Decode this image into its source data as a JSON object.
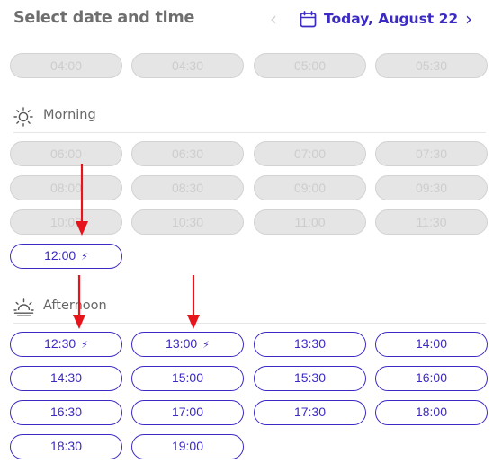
{
  "header": {
    "title": "Select date and time",
    "date_label": "Today, August 22",
    "prev_icon": "chevron-left-icon",
    "next_icon": "chevron-right-icon",
    "calendar_icon": "calendar-icon"
  },
  "colors": {
    "accent": "#3b2ac4",
    "disabled_bg": "#e5e5e5",
    "disabled_text": "#cdcdcd",
    "annotation_arrow": "#e8141b"
  },
  "early": {
    "slots": [
      {
        "time": "04:00",
        "available": false
      },
      {
        "time": "04:30",
        "available": false
      },
      {
        "time": "05:00",
        "available": false
      },
      {
        "time": "05:30",
        "available": false
      }
    ]
  },
  "morning": {
    "label": "Morning",
    "icon": "sun-icon",
    "slots": [
      {
        "time": "06:00",
        "available": false
      },
      {
        "time": "06:30",
        "available": false
      },
      {
        "time": "07:00",
        "available": false
      },
      {
        "time": "07:30",
        "available": false
      },
      {
        "time": "08:00",
        "available": false
      },
      {
        "time": "08:30",
        "available": false
      },
      {
        "time": "09:00",
        "available": false
      },
      {
        "time": "09:30",
        "available": false
      },
      {
        "time": "10:00",
        "available": false
      },
      {
        "time": "10:30",
        "available": false
      },
      {
        "time": "11:00",
        "available": false
      },
      {
        "time": "11:30",
        "available": false
      },
      {
        "time": "12:00",
        "available": true,
        "bolt": true
      }
    ]
  },
  "afternoon": {
    "label": "Afternoon",
    "icon": "sunset-icon",
    "slots": [
      {
        "time": "12:30",
        "available": true,
        "bolt": true
      },
      {
        "time": "13:00",
        "available": true,
        "bolt": true
      },
      {
        "time": "13:30",
        "available": true
      },
      {
        "time": "14:00",
        "available": true
      },
      {
        "time": "14:30",
        "available": true
      },
      {
        "time": "15:00",
        "available": true
      },
      {
        "time": "15:30",
        "available": true
      },
      {
        "time": "16:00",
        "available": true
      },
      {
        "time": "16:30",
        "available": true
      },
      {
        "time": "17:00",
        "available": true
      },
      {
        "time": "17:30",
        "available": true
      },
      {
        "time": "18:00",
        "available": true
      },
      {
        "time": "18:30",
        "available": true
      },
      {
        "time": "19:00",
        "available": true
      }
    ]
  }
}
